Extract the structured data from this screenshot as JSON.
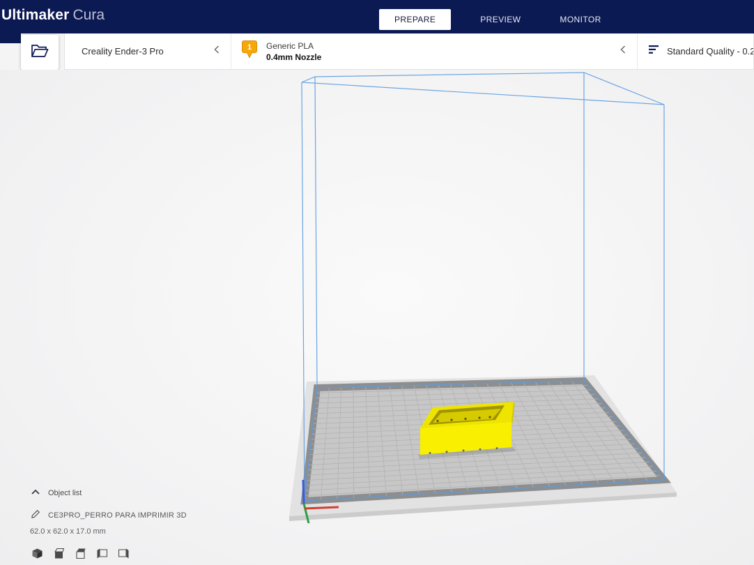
{
  "header": {
    "logo": {
      "bold": "Ultimaker",
      "light": "Cura"
    },
    "tabs": [
      {
        "label": "PREPARE",
        "active": true
      },
      {
        "label": "PREVIEW",
        "active": false
      },
      {
        "label": "MONITOR",
        "active": false
      }
    ]
  },
  "config_bar": {
    "printer_name": "Creality Ender-3 Pro",
    "material": {
      "extruder_number": "1",
      "name": "Generic PLA",
      "nozzle": "0.4mm Nozzle"
    },
    "profile_label": "Standard Quality - 0.2"
  },
  "tool_sidebar": {
    "tools": [
      "move-tool",
      "scale-tool",
      "rotate-tool",
      "mirror-tool",
      "per-model-settings-tool",
      "support-blocker-tool"
    ]
  },
  "object_panel": {
    "object_list_label": "Object list",
    "model_name": "CE3PRO_PERRO PARA IMPRIMIR 3D",
    "model_dimensions": "62.0 x 62.0 x 17.0 mm"
  },
  "viewport": {
    "model_color": "#f6ee00",
    "build_volume_outline": "#5b9ce0",
    "buildplate_grid": "on"
  },
  "colors": {
    "header_bg": "#0c1a54",
    "active_tab_bg": "#ffffff",
    "extruder_badge": "#f6a80b",
    "axis_x_red": "#d23f31",
    "axis_y_green": "#2f9e44",
    "axis_z_blue": "#3b5bdb"
  }
}
